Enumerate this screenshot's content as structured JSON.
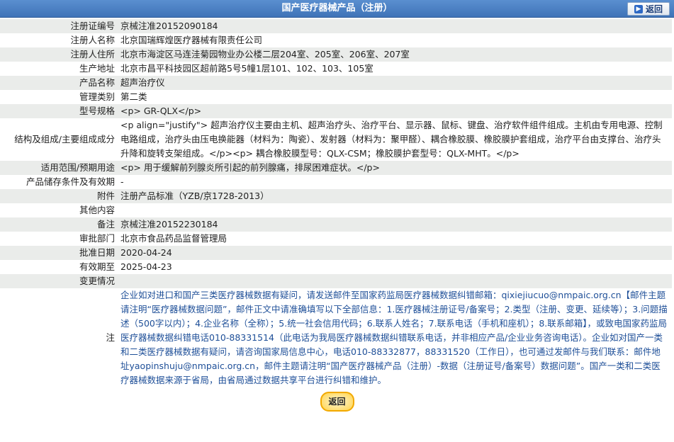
{
  "header": {
    "title": "国产医疗器械产品（注册）",
    "back_label": "返回"
  },
  "rows": [
    {
      "label": "注册证编号",
      "value": "京械注准20152090184"
    },
    {
      "label": "注册人名称",
      "value": "北京国瑞辉煌医疗器械有限责任公司"
    },
    {
      "label": "注册人住所",
      "value": "北京市海淀区马连洼菊园物业办公楼二层204室、205室、206室、207室"
    },
    {
      "label": "生产地址",
      "value": "北京市昌平科技园区超前路5号5幢1层101、102、103、105室"
    },
    {
      "label": "产品名称",
      "value": "超声治疗仪"
    },
    {
      "label": "管理类别",
      "value": "第二类"
    },
    {
      "label": "型号规格",
      "value": "<p> GR-QLX</p>"
    },
    {
      "label": "结构及组成/主要组成成分",
      "value": "<p align=\"justify\"> 超声治疗仪主要由主机、超声治疗头、治疗平台、显示器、鼠标、键盘、治疗软件组件组成。主机由专用电源、控制电路组成，治疗头由压电换能器（材料为：陶瓷）、发射器（材料为：聚甲醛）、耦合橡胶膜、橡胶膜护套组成，治疗平台由支撑台、治疗头升降和旋转支架组成。</p><p> 耦合橡胶膜型号：QLX-CSM；橡胶膜护套型号：QLX-MHT。</p>"
    },
    {
      "label": "适用范围/预期用途",
      "value": "<p> 用于缓解前列腺炎所引起的前列腺痛，排尿困难症状。</p>"
    },
    {
      "label": "产品储存条件及有效期",
      "value": "-"
    },
    {
      "label": "附件",
      "value": "注册产品标准（YZB/京1728-2013）"
    },
    {
      "label": "其他内容",
      "value": ""
    },
    {
      "label": "备注",
      "value": "京械注准20152230184"
    },
    {
      "label": "审批部门",
      "value": "北京市食品药品监督管理局"
    },
    {
      "label": "批准日期",
      "value": "2020-04-24"
    },
    {
      "label": "有效期至",
      "value": "2025-04-23"
    },
    {
      "label": "变更情况",
      "value": ""
    }
  ],
  "note": {
    "label": "注",
    "text": "企业如对进口和国产三类医疗器械数据有疑问，请发送邮件至国家药监局医疗器械数据纠错邮箱：qixiejiucuo@nmpaic.org.cn【邮件主题请注明“医疗器械数据问题”，邮件正文中请准确填写以下全部信息：1.医疗器械注册证号/备案号；2.类型（注册、变更、延续等）；3.问题描述（500字以内）；4.企业名称（全称）；5.统一社会信用代码；6.联系人姓名；7.联系电话（手机和座机）；8.联系邮箱】，或致电国家药监局医疗器械数据纠错电话010-88331514（此电话为我局医疗器械数据纠错联系电话，并非相应产品/企业业务咨询电话）。企业如对国产一类和二类医疗器械数据有疑问，请咨询国家局信息中心，电话010-88332877，88331520（工作日），也可通过发邮件与我们联系：邮件地址yaopinshuju@nmpaic.org.cn，邮件主题请注明“国产医疗器械产品（注册）-数据（注册证号/备案号）数据问题”。国产一类和二类医疗器械数据来源于省局，由省局通过数据共享平台进行纠错和维护。"
  },
  "footer": {
    "back_label": "返回"
  }
}
